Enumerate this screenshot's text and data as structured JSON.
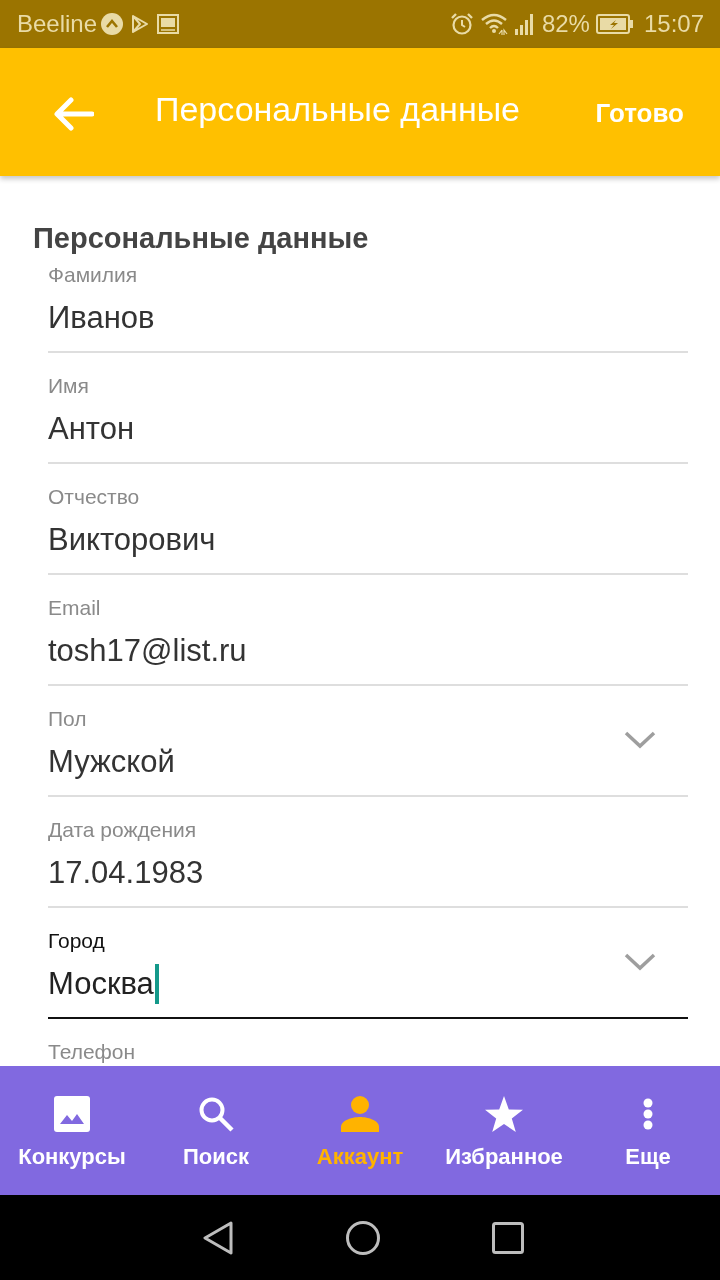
{
  "status_bar": {
    "carrier": "Beeline",
    "battery": "82%",
    "time": "15:07"
  },
  "app_bar": {
    "title": "Персональные данные",
    "action": "Готово"
  },
  "form": {
    "section_title": "Персональные данные",
    "fields": [
      {
        "kind": "text",
        "label": "Фамилия",
        "value": "Иванов",
        "focused": false
      },
      {
        "kind": "text",
        "label": "Имя",
        "value": "Антон",
        "focused": false
      },
      {
        "kind": "text",
        "label": "Отчество",
        "value": "Викторович",
        "focused": false
      },
      {
        "kind": "text",
        "label": "Email",
        "value": "tosh17@list.ru",
        "focused": false
      },
      {
        "kind": "dropdown",
        "label": "Пол",
        "value": "Мужской",
        "focused": false
      },
      {
        "kind": "text",
        "label": "Дата рождения",
        "value": "17.04.1983",
        "focused": false
      },
      {
        "kind": "dropdown",
        "label": "Город",
        "value": "Москва",
        "focused": true
      },
      {
        "kind": "text",
        "label": "Телефон",
        "focused": false
      }
    ]
  },
  "bottom_nav": [
    {
      "label": "Конкурсы",
      "selected": false
    },
    {
      "label": "Поиск",
      "selected": false
    },
    {
      "label": "Аккаунт",
      "selected": true
    },
    {
      "label": "Избранное",
      "selected": false
    },
    {
      "label": "Еще",
      "selected": false
    }
  ]
}
